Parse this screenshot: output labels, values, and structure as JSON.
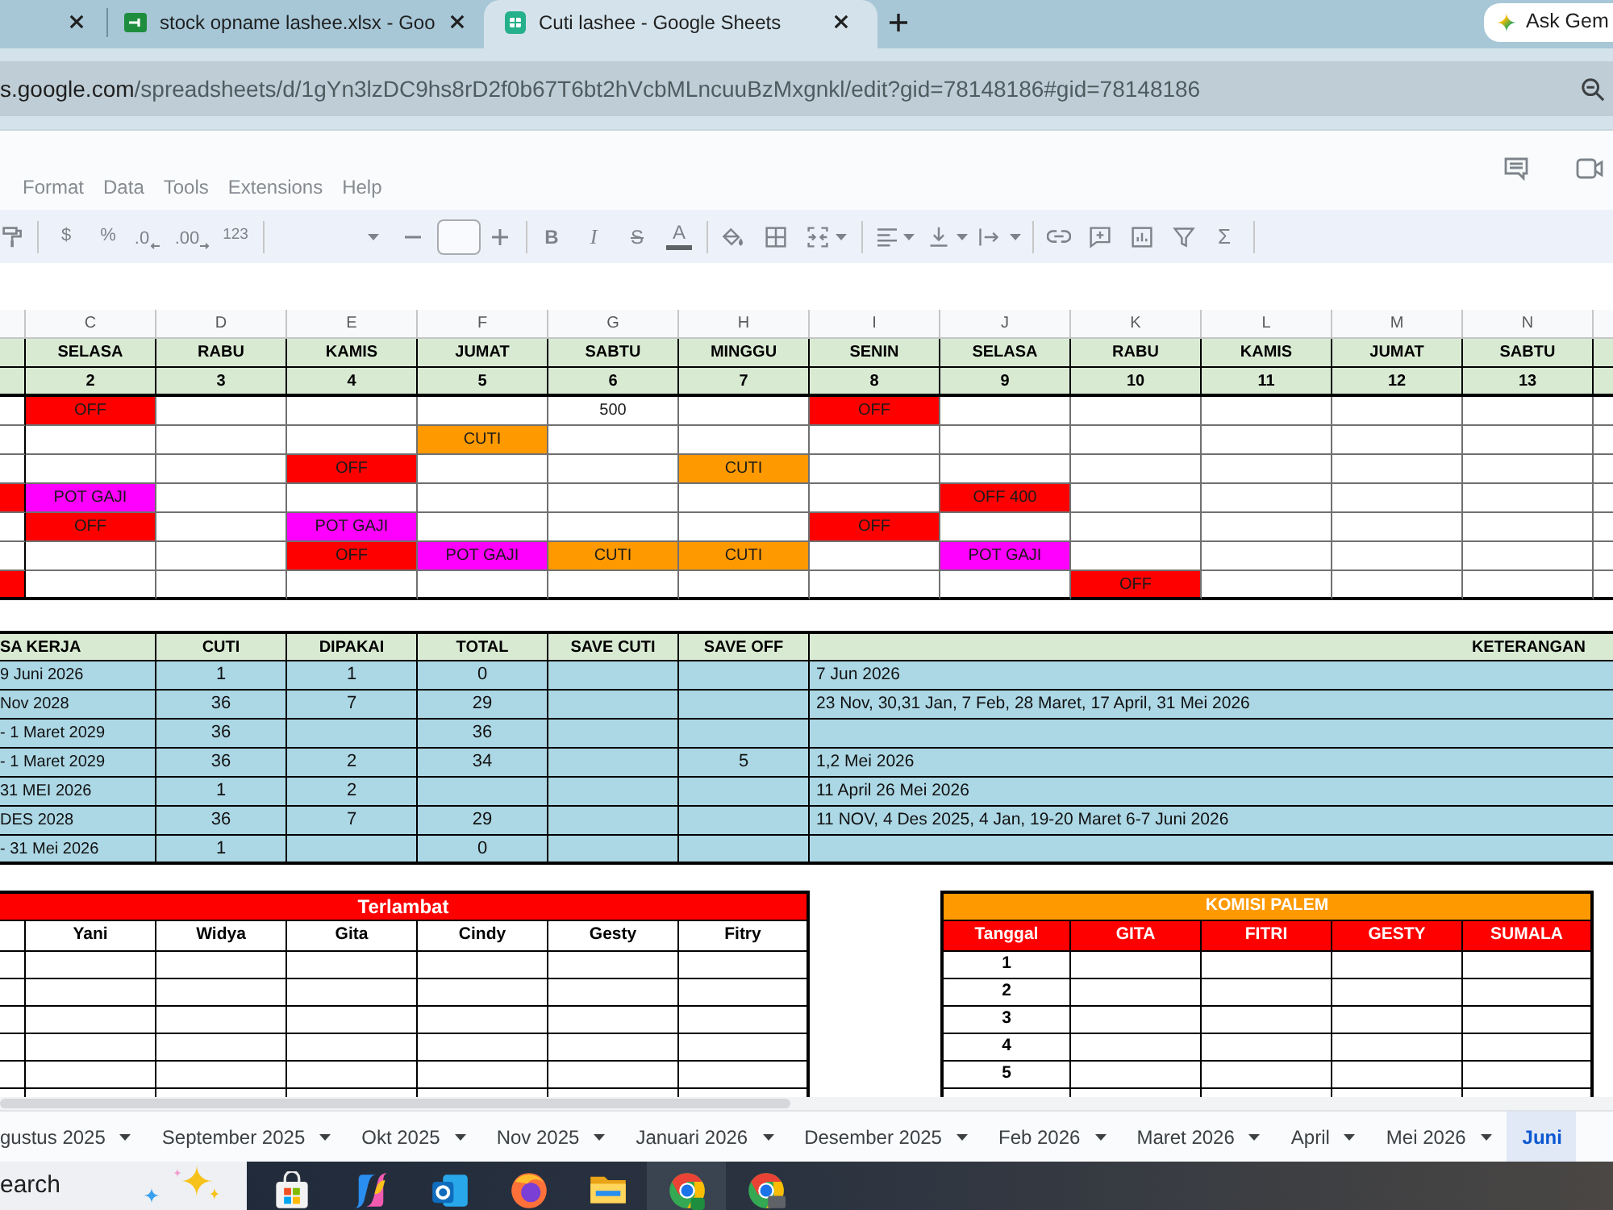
{
  "browser": {
    "tabs": [
      {
        "selected": false
      },
      {
        "title": "stock opname lashee.xlsx - Goo",
        "selected": false
      },
      {
        "title": "Cuti lashee - Google Sheets",
        "selected": true
      }
    ],
    "ask_button": "Ask Gem",
    "address": {
      "host": "s.google.com",
      "path": "/spreadsheets/d/1gYn3lzDC9hs8rD2f0b67T6bt2hVcbMLncuuBzMxgnkl/edit?gid=78148186#gid=78148186"
    }
  },
  "menu": [
    "Format",
    "Data",
    "Tools",
    "Extensions",
    "Help"
  ],
  "toolbar": {
    "currency": "$",
    "percent": "%",
    "decrease_decimals": ".0",
    "increase_decimals": ".00",
    "number_format": "123",
    "bold": "B",
    "italic": "I",
    "strikethrough": "S",
    "text_color": "A",
    "functions": "Σ"
  },
  "column_headers": [
    "C",
    "D",
    "E",
    "F",
    "G",
    "H",
    "I",
    "J",
    "K",
    "L",
    "M",
    "N"
  ],
  "schedule": {
    "days": [
      "SELASA",
      "RABU",
      "KAMIS",
      "JUMAT",
      "SABTU",
      "MINGGU",
      "SENIN",
      "SELASA",
      "RABU",
      "KAMIS",
      "JUMAT",
      "SABTU"
    ],
    "dates": [
      "2",
      "3",
      "4",
      "5",
      "6",
      "7",
      "8",
      "9",
      "10",
      "11",
      "12",
      "13"
    ],
    "rows": [
      [
        null,
        {
          "text": "OFF",
          "color": "#ff0000"
        },
        null,
        null,
        null,
        {
          "text": "500"
        },
        null,
        {
          "text": "OFF",
          "color": "#ff0000"
        },
        null,
        null,
        null,
        null,
        null
      ],
      [
        null,
        null,
        null,
        null,
        {
          "text": "CUTI",
          "color": "#ff9900"
        },
        null,
        null,
        null,
        null,
        null,
        null,
        null,
        null
      ],
      [
        null,
        null,
        null,
        {
          "text": "OFF",
          "color": "#ff0000"
        },
        null,
        null,
        {
          "text": "CUTI",
          "color": "#ff9900"
        },
        null,
        null,
        null,
        null,
        null,
        null
      ],
      [
        {
          "color": "#ff0000"
        },
        {
          "text": "POT GAJI",
          "color": "#ff00ff"
        },
        null,
        null,
        null,
        null,
        null,
        null,
        {
          "text": "OFF 400",
          "color": "#ff0000"
        },
        null,
        null,
        null,
        null
      ],
      [
        null,
        {
          "text": "OFF",
          "color": "#ff0000"
        },
        null,
        {
          "text": "POT GAJI",
          "color": "#ff00ff"
        },
        null,
        null,
        null,
        {
          "text": "OFF",
          "color": "#ff0000"
        },
        null,
        null,
        null,
        null,
        null
      ],
      [
        null,
        null,
        null,
        {
          "text": "OFF",
          "color": "#ff0000"
        },
        {
          "text": "POT GAJI",
          "color": "#ff00ff"
        },
        {
          "text": "CUTI",
          "color": "#ff9900"
        },
        {
          "text": "CUTI",
          "color": "#ff9900"
        },
        null,
        {
          "text": "POT GAJI",
          "color": "#ff00ff"
        },
        null,
        null,
        null,
        null
      ],
      [
        {
          "color": "#ff0000"
        },
        null,
        null,
        null,
        null,
        null,
        null,
        null,
        null,
        {
          "text": "OFF",
          "color": "#ff0000"
        },
        null,
        null,
        null
      ]
    ]
  },
  "leave_table": {
    "columns": [
      "SA KERJA",
      "CUTI",
      "DIPAKAI",
      "TOTAL",
      "SAVE CUTI",
      "SAVE OFF",
      "KETERANGAN"
    ],
    "rows": [
      [
        "9 Juni 2026",
        "1",
        "1",
        "0",
        null,
        null,
        "7 Jun 2026"
      ],
      [
        "Nov 2028",
        "36",
        "7",
        "29",
        null,
        null,
        "23 Nov, 30,31 Jan, 7 Feb, 28 Maret, 17 April, 31 Mei 2026"
      ],
      [
        "- 1 Maret 2029",
        "36",
        null,
        "36",
        null,
        null,
        null
      ],
      [
        "- 1 Maret 2029",
        "36",
        "2",
        "34",
        null,
        "5",
        "1,2 Mei 2026"
      ],
      [
        "31 MEI 2026",
        "1",
        "2",
        null,
        null,
        null,
        "11 April 26 Mei 2026"
      ],
      [
        "DES 2028",
        "36",
        "7",
        "29",
        null,
        null,
        "11 NOV, 4 Des 2025, 4 Jan, 19-20 Maret 6-7 Juni 2026"
      ],
      [
        "- 31 Mei 2026",
        "1",
        null,
        "0",
        null,
        null,
        null
      ]
    ]
  },
  "late_table": {
    "title": "Terlambat",
    "columns": [
      "Yani",
      "Widya",
      "Gita",
      "Cindy",
      "Gesty",
      "Fitry"
    ]
  },
  "commission_table": {
    "title": "KOMISI PALEM",
    "columns": [
      "Tanggal",
      "GITA",
      "FITRI",
      "GESTY",
      "SUMALA"
    ],
    "rows": [
      "1",
      "2",
      "3",
      "4",
      "5"
    ]
  },
  "sheet_tabs": [
    {
      "label": "gustus 2025",
      "selected": false
    },
    {
      "label": "September 2025",
      "selected": false
    },
    {
      "label": "Okt 2025",
      "selected": false
    },
    {
      "label": "Nov 2025",
      "selected": false
    },
    {
      "label": "Januari 2026",
      "selected": false
    },
    {
      "label": "Desember 2025",
      "selected": false
    },
    {
      "label": "Feb 2026",
      "selected": false
    },
    {
      "label": "Maret 2026",
      "selected": false
    },
    {
      "label": "April",
      "selected": false
    },
    {
      "label": "Mei 2026",
      "selected": false
    },
    {
      "label": "Juni",
      "selected": true
    }
  ],
  "taskbar": {
    "placeholder": "earch",
    "apps": [
      {
        "selected": false
      },
      {
        "selected": false
      },
      {
        "selected": false
      },
      {
        "selected": false
      },
      {
        "selected": false
      },
      {
        "selected": true
      },
      {
        "selected": false
      }
    ]
  }
}
